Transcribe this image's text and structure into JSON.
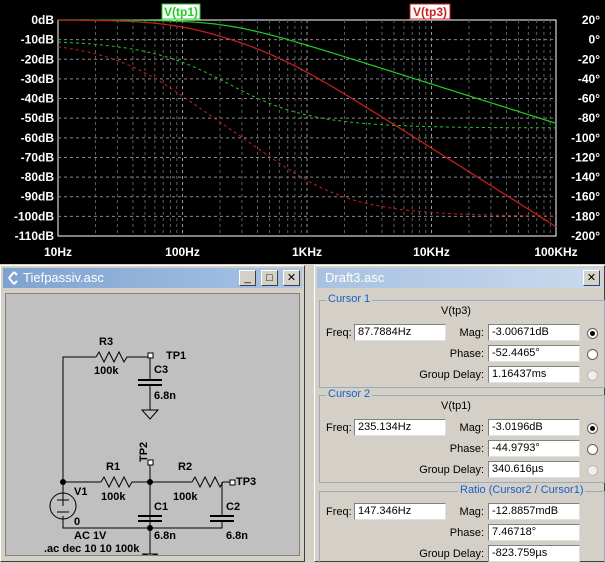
{
  "plot": {
    "trace1_label": "V(tp1)",
    "trace2_label": "V(tp3)",
    "trace1_color": "#22cc22",
    "trace2_color": "#cc2020",
    "left_ticks": [
      "0dB",
      "-10dB",
      "-20dB",
      "-30dB",
      "-40dB",
      "-50dB",
      "-60dB",
      "-70dB",
      "-80dB",
      "-90dB",
      "-100dB",
      "-110dB"
    ],
    "right_ticks": [
      "20°",
      "0°",
      "-20°",
      "-40°",
      "-60°",
      "-80°",
      "-100°",
      "-120°",
      "-140°",
      "-160°",
      "-180°",
      "-200°"
    ],
    "x_ticks": [
      "10Hz",
      "100Hz",
      "1KHz",
      "10KHz",
      "100KHz"
    ],
    "mag_ylim": [
      -110,
      0
    ],
    "phase_ylim": [
      -200,
      20
    ],
    "xlim_hz": [
      10,
      100000
    ]
  },
  "schematic_window": {
    "title": "Tiefpassiv.asc",
    "components": {
      "r3": "R3",
      "r3_val": "100k",
      "c3": "C3",
      "c3_val": "6.8n",
      "tp1": "TP1",
      "tp2": "TP2",
      "tp3": "TP3",
      "r1": "R1",
      "r1_val": "100k",
      "r2": "R2",
      "r2_val": "100k",
      "v1": "V1",
      "v1_dc": "0",
      "v1_ac": "AC 1V",
      "c1": "C1",
      "c1_val": "6.8n",
      "c2": "C2",
      "c2_val": "6.8n"
    },
    "directive": ".ac dec 10 10 100k",
    "buttons": {
      "minimize": "_",
      "maximize": "□",
      "close": "✕"
    }
  },
  "cursor_window": {
    "title": "Draft3.asc",
    "close": "✕",
    "labels": {
      "freq": "Freq:",
      "mag": "Mag:",
      "phase": "Phase:",
      "group_delay": "Group Delay:"
    },
    "cursor1": {
      "title": "Cursor 1",
      "trace": "V(tp3)",
      "freq": "87.7884Hz",
      "mag": "-3.00671dB",
      "phase": "-52.4465°",
      "group_delay": "1.16437ms"
    },
    "cursor2": {
      "title": "Cursor 2",
      "trace": "V(tp1)",
      "freq": "235.134Hz",
      "mag": "-3.0196dB",
      "phase": "-44.9793°",
      "group_delay": "340.616µs"
    },
    "ratio": {
      "title": "Ratio (Cursor2 / Cursor1)",
      "freq": "147.346Hz",
      "mag": "-12.8857mdB",
      "phase": "7.46718°",
      "group_delay": "-823.759µs"
    }
  }
}
